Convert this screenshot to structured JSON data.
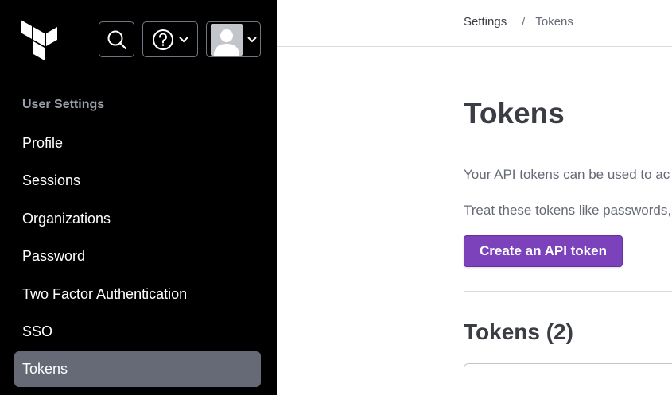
{
  "sidebar": {
    "section_label": "User Settings",
    "items": [
      {
        "label": "Profile",
        "active": false
      },
      {
        "label": "Sessions",
        "active": false
      },
      {
        "label": "Organizations",
        "active": false
      },
      {
        "label": "Password",
        "active": false
      },
      {
        "label": "Two Factor Authentication",
        "active": false
      },
      {
        "label": "SSO",
        "active": false
      },
      {
        "label": "Tokens",
        "active": true
      }
    ],
    "header_icons": [
      "terraform-logo",
      "search-icon",
      "help-icon",
      "avatar"
    ]
  },
  "breadcrumb": {
    "root": "Settings",
    "separator": "/",
    "current": "Tokens"
  },
  "main": {
    "title": "Tokens",
    "description_1": "Your API tokens can be used to ac",
    "description_2": "Treat these tokens like passwords,",
    "create_button": "Create an API token",
    "list_title": "Tokens (2)"
  },
  "colors": {
    "sidebar_bg": "#000000",
    "active_item_bg": "#656a76",
    "primary_button": "#7b42bc",
    "text_dark": "#3b3d45",
    "text_muted": "#656a76"
  }
}
